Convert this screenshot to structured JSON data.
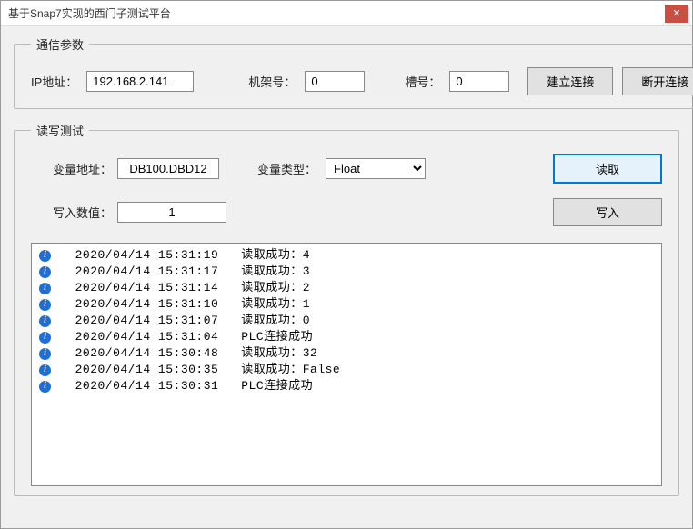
{
  "window": {
    "title": "基于Snap7实现的西门子测试平台"
  },
  "comm": {
    "legend": "通信参数",
    "ip_label": "IP地址：",
    "ip_value": "192.168.2.141",
    "rack_label": "机架号：",
    "rack_value": "0",
    "slot_label": "槽号：",
    "slot_value": "0",
    "connect_label": "建立连接",
    "disconnect_label": "断开连接"
  },
  "rw": {
    "legend": "读写测试",
    "addr_label": "变量地址：",
    "addr_value": "DB100.DBD12",
    "type_label": "变量类型：",
    "type_value": "Float",
    "read_label": "读取",
    "write_val_label": "写入数值：",
    "write_val_value": "1",
    "write_label": "写入"
  },
  "log": [
    {
      "time": "2020/04/14 15:31:19",
      "msg": "读取成功：4"
    },
    {
      "time": "2020/04/14 15:31:17",
      "msg": "读取成功：3"
    },
    {
      "time": "2020/04/14 15:31:14",
      "msg": "读取成功：2"
    },
    {
      "time": "2020/04/14 15:31:10",
      "msg": "读取成功：1"
    },
    {
      "time": "2020/04/14 15:31:07",
      "msg": "读取成功：0"
    },
    {
      "time": "2020/04/14 15:31:04",
      "msg": "PLC连接成功"
    },
    {
      "time": "2020/04/14 15:30:48",
      "msg": "读取成功：32"
    },
    {
      "time": "2020/04/14 15:30:35",
      "msg": "读取成功：False"
    },
    {
      "time": "2020/04/14 15:30:31",
      "msg": "PLC连接成功"
    }
  ]
}
